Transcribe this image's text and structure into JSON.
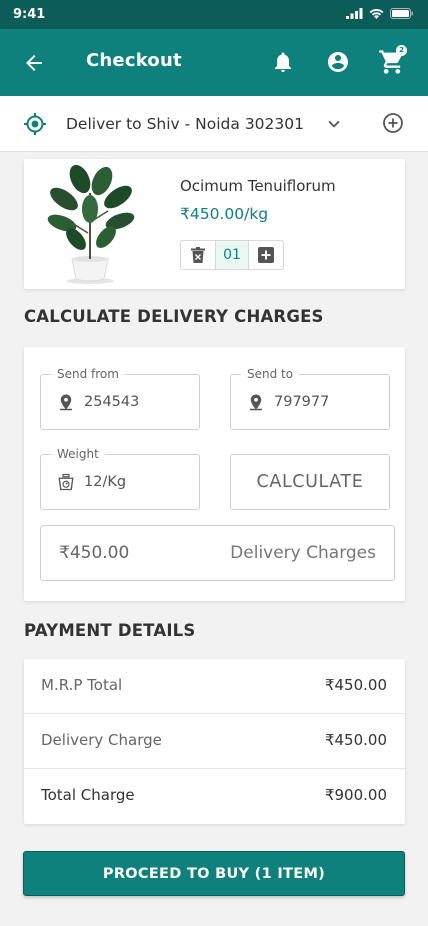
{
  "status_bar": {
    "time": "9:41"
  },
  "header": {
    "title": "Checkout",
    "cart_count": "2"
  },
  "delivery": {
    "text": "Deliver to Shiv - Noida 302301"
  },
  "product": {
    "name": "Ocimum Tenuiflorum",
    "price": "₹450.00/kg",
    "quantity": "01"
  },
  "calculate": {
    "title": "CALCULATE DELIVERY CHARGES",
    "send_from_label": "Send from",
    "send_from_value": "254543",
    "send_to_label": "Send to",
    "send_to_value": "797977",
    "weight_label": "Weight",
    "weight_value": "12/Kg",
    "calculate_button": "CALCULATE",
    "charge_amount": "₹450.00",
    "charge_label": "Delivery Charges"
  },
  "payment": {
    "title": "PAYMENT DETAILS",
    "rows": [
      {
        "label": "M.R.P Total",
        "value": "₹450.00"
      },
      {
        "label": "Delivery Charge",
        "value": "₹450.00"
      },
      {
        "label": "Total Charge",
        "value": "₹900.00"
      }
    ]
  },
  "proceed_button": "PROCEED TO BUY (1 ITEM)",
  "colors": {
    "primary": "#0f817c",
    "status_bar": "#0c5d59",
    "background": "#f2f2f2"
  }
}
